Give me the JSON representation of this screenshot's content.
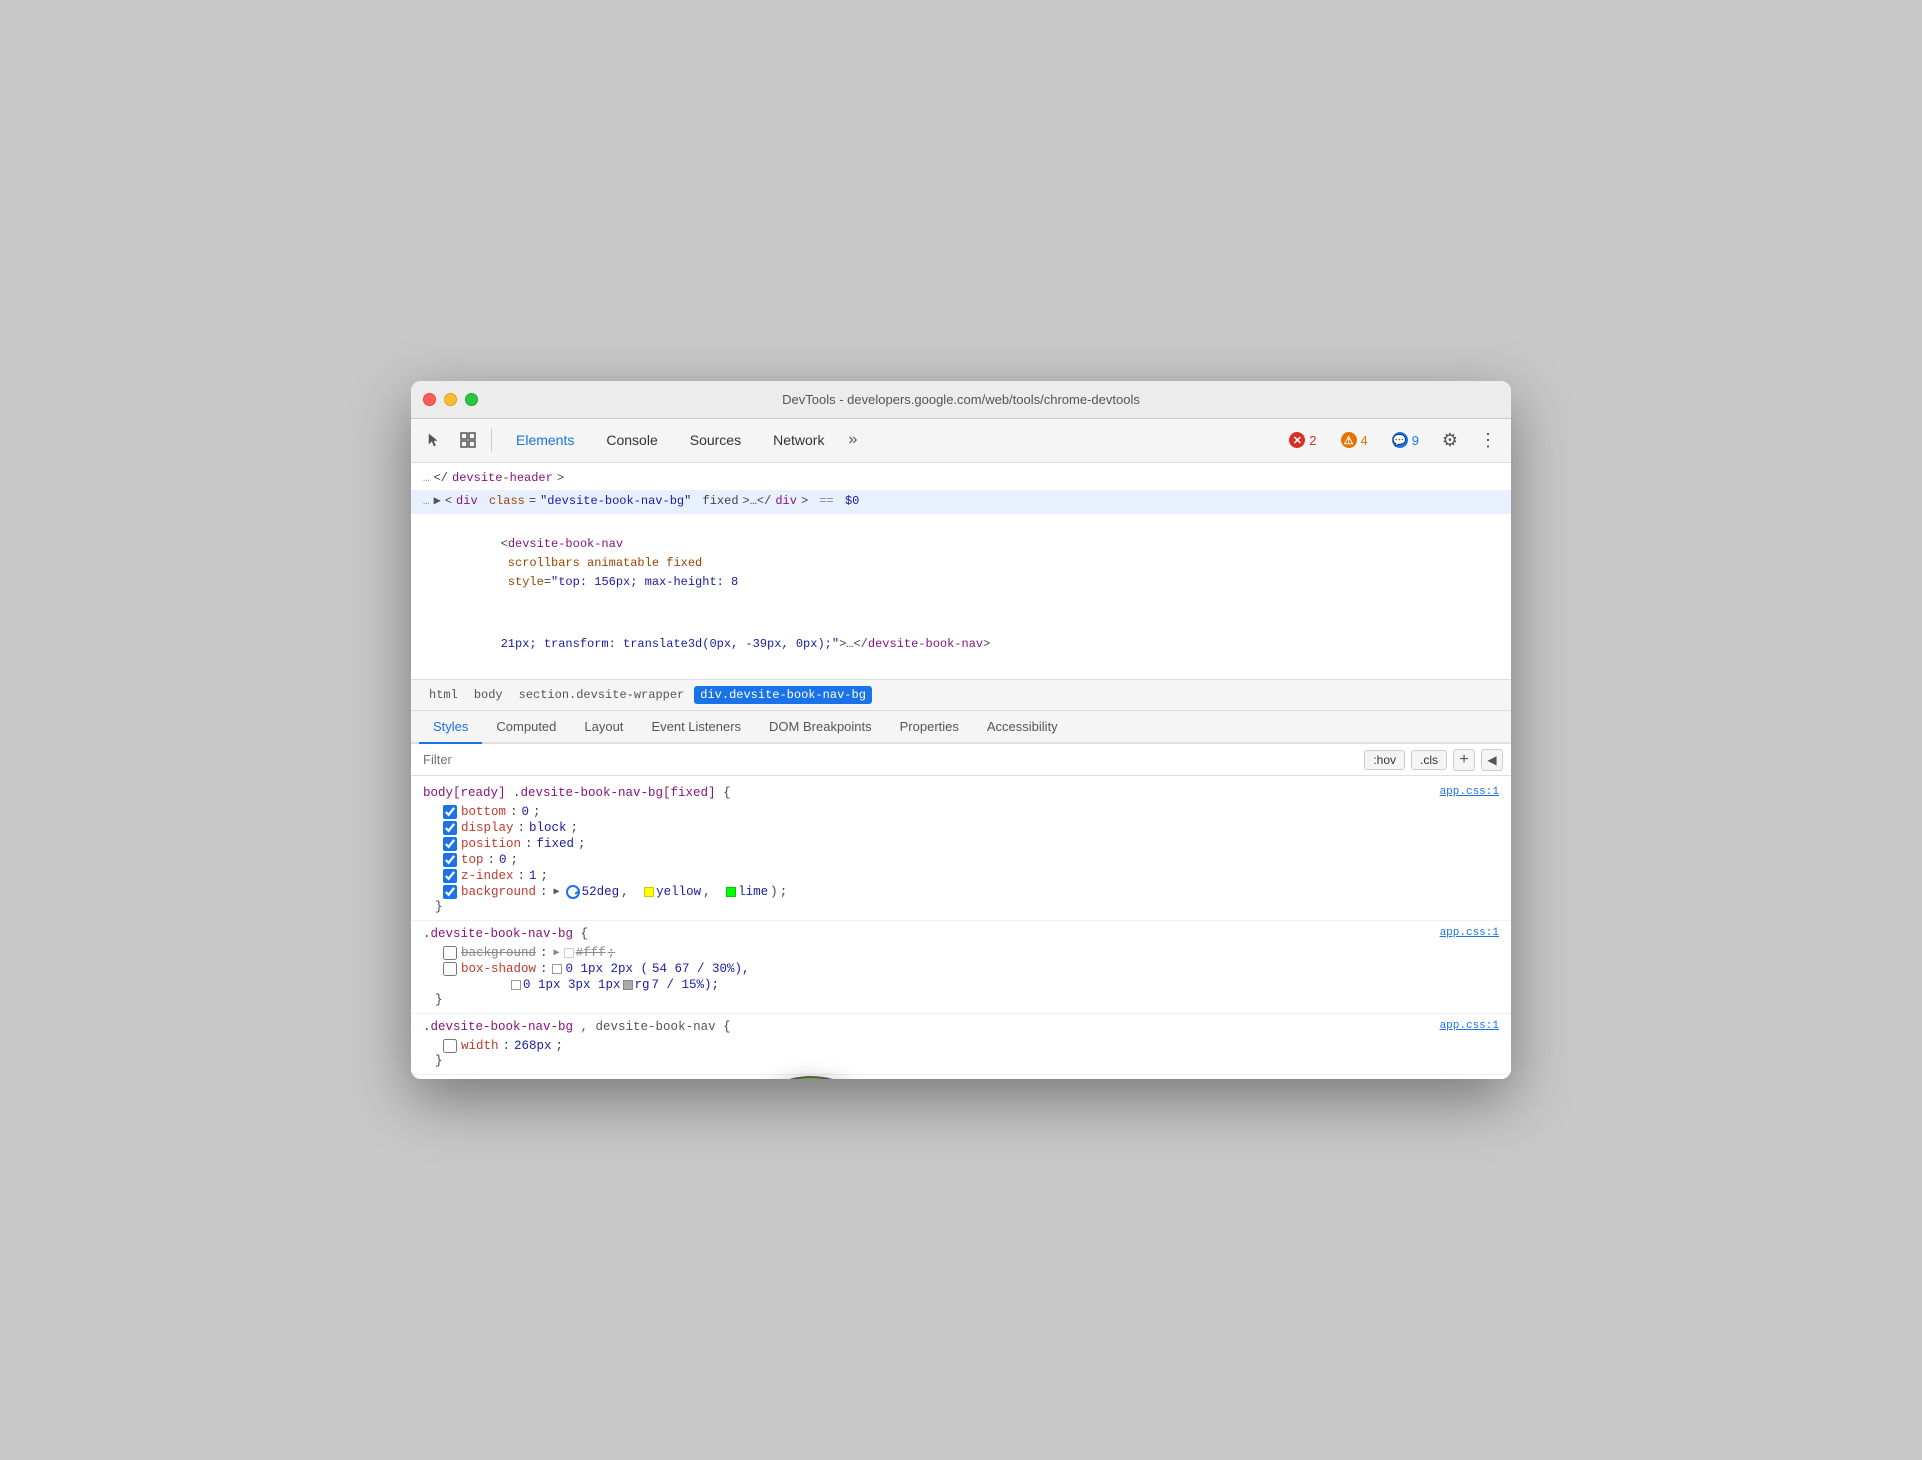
{
  "window": {
    "title": "DevTools - developers.google.com/web/tools/chrome-devtools"
  },
  "toolbar": {
    "tabs": [
      {
        "id": "elements",
        "label": "Elements",
        "active": true
      },
      {
        "id": "console",
        "label": "Console",
        "active": false
      },
      {
        "id": "sources",
        "label": "Sources",
        "active": false
      },
      {
        "id": "network",
        "label": "Network",
        "active": false
      }
    ],
    "more_label": "»",
    "errors_count": "2",
    "warnings_count": "4",
    "messages_count": "9",
    "settings_icon": "⚙",
    "more_icon": "⋮"
  },
  "html_panel": {
    "line1": "</devsite-header>",
    "line2_prefix": "▶ <div class=",
    "line2_class": "\"devsite-book-nav-bg\"",
    "line2_suffix": " fixed>…</div> == $0",
    "line3": "<devsite-book-nav scrollbars animatable fixed style=\"top: 156px; max-height: 8",
    "line4": "21px; transform: translate3d(0px, -39px, 0px);\">…</devsite-book-nav>"
  },
  "breadcrumb": {
    "items": [
      {
        "id": "html",
        "label": "html",
        "active": false
      },
      {
        "id": "body",
        "label": "body",
        "active": false
      },
      {
        "id": "section",
        "label": "section.devsite-wrapper",
        "active": false
      },
      {
        "id": "div",
        "label": "div.devsite-book-nav-bg",
        "active": true
      }
    ]
  },
  "css_tabs": {
    "tabs": [
      {
        "id": "styles",
        "label": "Styles",
        "active": true
      },
      {
        "id": "computed",
        "label": "Computed",
        "active": false
      },
      {
        "id": "layout",
        "label": "Layout",
        "active": false
      },
      {
        "id": "event-listeners",
        "label": "Event Listeners",
        "active": false
      },
      {
        "id": "dom-breakpoints",
        "label": "DOM Breakpoints",
        "active": false
      },
      {
        "id": "properties",
        "label": "Properties",
        "active": false
      },
      {
        "id": "accessibility",
        "label": "Accessibility",
        "active": false
      }
    ]
  },
  "filter": {
    "placeholder": "Filter",
    "hov_label": ":hov",
    "cls_label": ".cls",
    "plus_label": "+",
    "arrow_label": "◀"
  },
  "css_rules": [
    {
      "id": "rule1",
      "selector": "body[ready] .devsite-book-nav-bg[fixed]",
      "brace_open": " {",
      "link": "app.css:1",
      "properties": [
        {
          "id": "p1",
          "checked": true,
          "name": "bottom",
          "value": "0",
          "unit": ";",
          "strikethrough": false
        },
        {
          "id": "p2",
          "checked": true,
          "name": "display",
          "value": "block",
          "unit": ";",
          "strikethrough": false
        },
        {
          "id": "p3",
          "checked": true,
          "name": "position",
          "value": "fixed",
          "unit": ";",
          "strikethrough": false
        },
        {
          "id": "p4",
          "checked": true,
          "name": "top",
          "value": "0",
          "unit": ";",
          "strikethrough": false
        },
        {
          "id": "p5",
          "checked": true,
          "name": "z-index",
          "value": "1",
          "unit": ";",
          "strikethrough": false
        },
        {
          "id": "p6",
          "checked": true,
          "name": "background",
          "value": "linear-gradient(52deg, yellow, lime)",
          "unit": ";",
          "strikethrough": false,
          "has_gradient": true
        }
      ]
    },
    {
      "id": "rule2",
      "selector": ".devsite-book-nav-bg",
      "brace_open": " {",
      "link": "app.css:1",
      "properties": [
        {
          "id": "p7",
          "checked": false,
          "name": "background",
          "value": "▶  #fff",
          "unit": ";",
          "strikethrough": true
        },
        {
          "id": "p8",
          "checked": false,
          "name": "box-shadow",
          "value": "□ 0 1px 2px ( 54 67 / 30%),",
          "unit": "",
          "strikethrough": false
        },
        {
          "id": "p8b",
          "checked": false,
          "name": "",
          "value": "□ 0 1px 3px 1px □ rg 7 / 15%)",
          "unit": ";",
          "strikethrough": false
        }
      ]
    },
    {
      "id": "rule3",
      "selector": ".devsite-book-nav-bg, devsite-book-nav",
      "brace_open": " {",
      "link": "app.css:1",
      "properties": [
        {
          "id": "p9",
          "checked": false,
          "name": "width",
          "value": "268px",
          "unit": ";",
          "strikethrough": false
        }
      ]
    }
  ],
  "angle_clock": {
    "angle": "52deg",
    "gradient_start": "yellow",
    "gradient_end": "lime"
  }
}
